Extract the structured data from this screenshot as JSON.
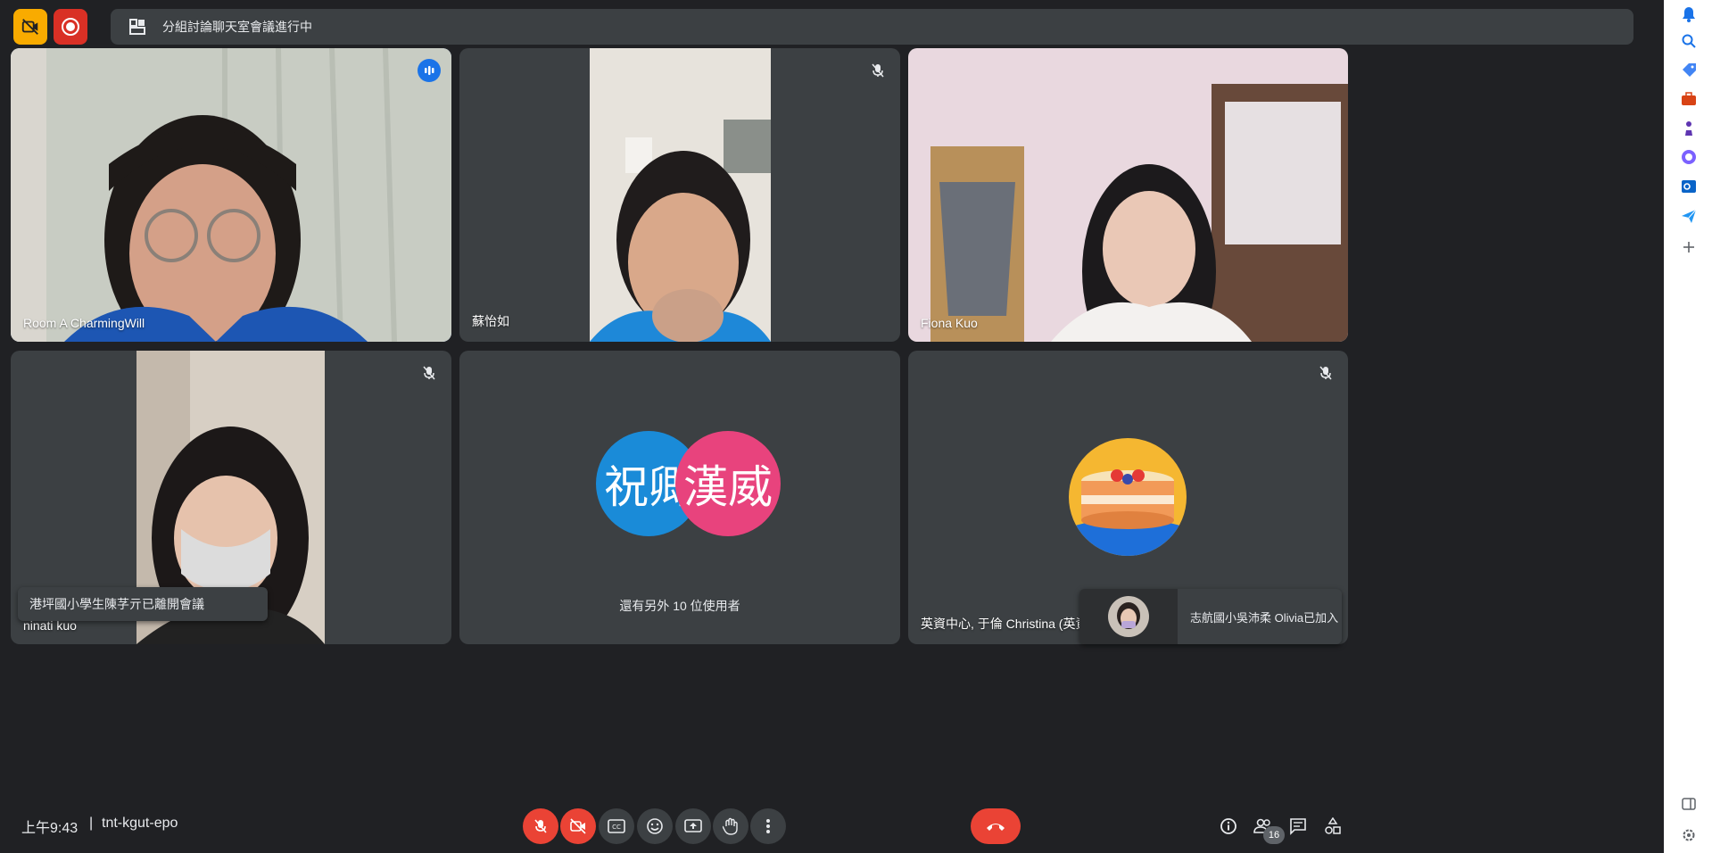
{
  "banner": {
    "text": "分組討論聊天室會議進行中"
  },
  "tiles": [
    {
      "name": "Room A CharmingWill"
    },
    {
      "name": "蘇怡如"
    },
    {
      "name": "Fiona Kuo"
    },
    {
      "name": "ninati kuo"
    },
    {
      "avatars": [
        "祝卿",
        "漢威"
      ],
      "more_text": "還有另外 10 位使用者"
    },
    {
      "name": "英資中心, 于倫 Christina (英資中心"
    }
  ],
  "toasts": {
    "left": "港坪國小學生陳芓亓已離開會議",
    "right": "志航國小吳沛柔 Olivia已加入"
  },
  "footer": {
    "time": "上午9:43",
    "separator": "|",
    "meeting_code": "tnt-kgut-epo",
    "participant_count": "16"
  },
  "colors": {
    "avatar_1": "#1a8bd8",
    "avatar_2": "#e8437d",
    "danger": "#ea4335",
    "accent": "#8ab4f8"
  }
}
